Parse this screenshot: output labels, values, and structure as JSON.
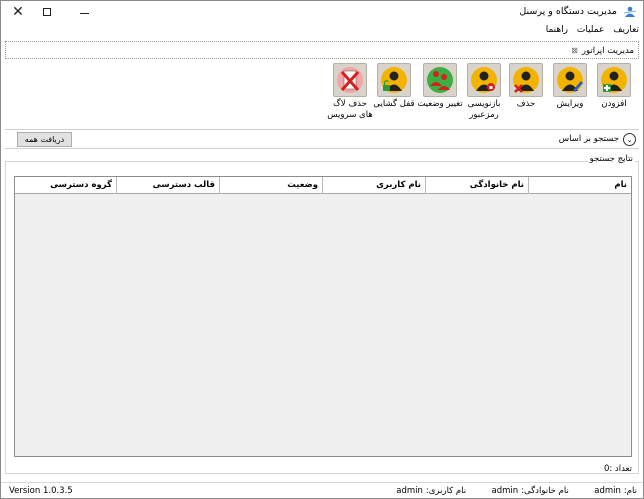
{
  "window": {
    "title": "مدیریت دستگاه و پرسنل",
    "close_glyph": "✕"
  },
  "menu": {
    "items": [
      "تعاریف",
      "عملیات",
      "راهنما"
    ]
  },
  "tab": {
    "label": "مدیریت اپراتور",
    "close_glyph": "⊠"
  },
  "toolbar": {
    "add": "افزودن",
    "edit": "ویرایش",
    "delete": "حذف",
    "reset_password_line1": "بازنویسی",
    "reset_password_line2": "رمزعبور",
    "change_status": "تغییر وضعیت",
    "unlock": "قفل گشایی",
    "delete_logs_line1": "حذف لاگ",
    "delete_logs_line2": "های سرویس"
  },
  "search": {
    "label": "جستجو بر اساس",
    "fetch_all": "دریافت همه"
  },
  "results": {
    "label": "نتایج جستجو",
    "columns": [
      "نام",
      "نام خانوادگی",
      "نام کاربری",
      "وضعیت",
      "قالب دسترسی",
      "گروه دسترسی"
    ],
    "rows": [],
    "count_label": "تعداد :",
    "count_value": "0"
  },
  "status": {
    "first_name_label": "نام:",
    "first_name_value": "admin",
    "last_name_label": "نام خانوادگی:",
    "last_name_value": "admin",
    "username_label": "نام کاربری:",
    "username_value": "admin",
    "version": "Version 1.0.3.5"
  },
  "colors": {
    "icon_bg": "#d8d4cc",
    "person_head": "#f2b400",
    "person_body": "#222222"
  }
}
